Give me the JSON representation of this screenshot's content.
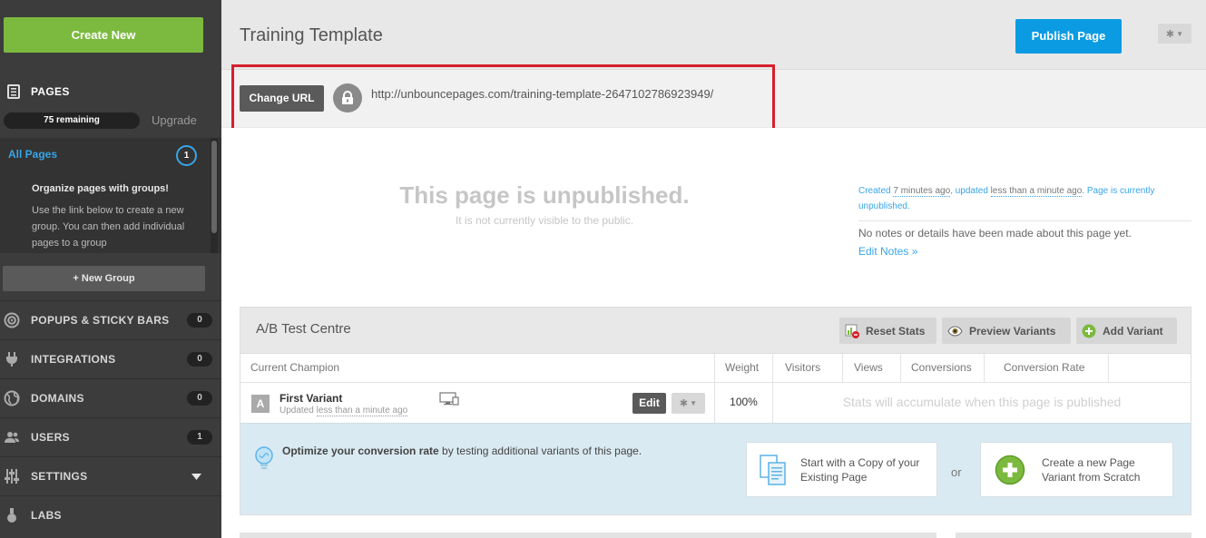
{
  "sidebar": {
    "create_label": "Create New",
    "pages_label": "PAGES",
    "remaining": "75 remaining",
    "upgrade": "Upgrade",
    "all_pages": "All Pages",
    "all_pages_count": "1",
    "organize_title": "Organize pages with groups!",
    "organize_text": "Use the link below to create a new group. You can then add individual pages to a group",
    "new_group": "+ New Group",
    "nav": [
      {
        "label": "POPUPS & STICKY BARS",
        "count": "0",
        "icon": "target-icon"
      },
      {
        "label": "INTEGRATIONS",
        "count": "0",
        "icon": "plug-icon"
      },
      {
        "label": "DOMAINS",
        "count": "0",
        "icon": "globe-icon"
      },
      {
        "label": "USERS",
        "count": "1",
        "icon": "users-icon"
      },
      {
        "label": "SETTINGS",
        "icon": "sliders-icon"
      },
      {
        "label": "LABS",
        "icon": "flask-icon"
      }
    ]
  },
  "header": {
    "title": "Training Template",
    "publish_label": "Publish Page",
    "settings_icon": "gear-icon"
  },
  "url": {
    "change_label": "Change URL",
    "value": "http://unbouncepages.com/training-template-2647102786923949/",
    "highlight_color": "#d61f2b"
  },
  "status": {
    "title": "This page is unpublished.",
    "subtitle": "It is not currently visible to the public.",
    "created_prefix": "Created ",
    "created_time": "7 minutes ago",
    "updated_prefix": ", updated ",
    "updated_time": "less than a minute ago",
    "suffix": ". Page is currently unpublished.",
    "notes": "No notes or details have been made about this page yet.",
    "edit_notes": "Edit Notes »"
  },
  "ab_test": {
    "title": "A/B Test Centre",
    "buttons": {
      "reset": "Reset Stats",
      "preview": "Preview Variants",
      "add": "Add Variant"
    },
    "columns": [
      "Current Champion",
      "Weight",
      "Visitors",
      "Views",
      "Conversions",
      "Conversion Rate"
    ],
    "variant": {
      "letter": "A",
      "name": "First Variant",
      "updated_prefix": "Updated ",
      "updated_time": "less than a minute ago",
      "edit_label": "Edit",
      "weight": "100%"
    },
    "stats_message": "Stats will accumulate when this page is published",
    "optimize_bold": "Optimize your conversion rate",
    "optimize_rest": " by testing additional variants of this page.",
    "copy_card": "Start with a Copy of your Existing Page",
    "or": "or",
    "new_card": "Create a new Page Variant from Scratch"
  },
  "colors": {
    "accent_green": "#7cba3f",
    "accent_blue": "#0b9be3",
    "link_blue": "#37a5e8"
  }
}
